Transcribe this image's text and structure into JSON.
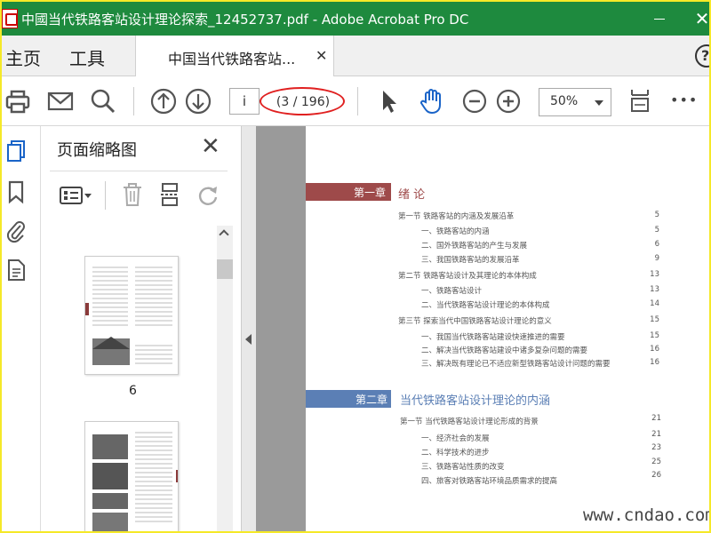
{
  "window": {
    "title": "中國当代铁路客站设计理论探索_12452737.pdf - Adobe Acrobat Pro DC",
    "minimize_glyph": "",
    "close_glyph": "✕"
  },
  "tabs": {
    "home": "主页",
    "tools": "工具",
    "document": "中国当代铁路客站...",
    "close_glyph": "✕",
    "help_glyph": "?"
  },
  "toolbar": {
    "page_input": "i",
    "page_count": "(3 / 196)",
    "zoom": "50%",
    "more_glyph": "•••"
  },
  "panel": {
    "title": "页面缩略图",
    "close_glyph": "✕",
    "thumbnails": [
      {
        "label": "6"
      }
    ]
  },
  "document": {
    "chapters": [
      {
        "label": "第一章",
        "title": "绪 论",
        "color": "#9e4a4a",
        "sections": [
          {
            "text": "第一节  铁路客站的内涵及发展沿革",
            "page": "5",
            "indent": 0
          },
          {
            "text": "一、铁路客站的内涵",
            "page": "5",
            "indent": 1
          },
          {
            "text": "二、国外铁路客站的产生与发展",
            "page": "6",
            "indent": 1
          },
          {
            "text": "三、我国铁路客站的发展沿革",
            "page": "9",
            "indent": 1
          },
          {
            "text": "第二节  铁路客站设计及其理论的本体构成",
            "page": "13",
            "indent": 0
          },
          {
            "text": "一、铁路客站设计",
            "page": "13",
            "indent": 1
          },
          {
            "text": "二、当代铁路客站设计理论的本体构成",
            "page": "14",
            "indent": 1
          },
          {
            "text": "第三节  探索当代中国铁路客站设计理论的意义",
            "page": "15",
            "indent": 0
          },
          {
            "text": "一、我国当代铁路客站建设快速推进的需要",
            "page": "15",
            "indent": 1
          },
          {
            "text": "二、解决当代铁路客站建设中诸多复杂问题的需要",
            "page": "16",
            "indent": 1
          },
          {
            "text": "三、解决既有理论已不适应新型铁路客站设计问题的需要",
            "page": "16",
            "indent": 1
          }
        ]
      },
      {
        "label": "第二章",
        "title": "当代铁路客站设计理论的内涵",
        "color": "#5b7fb5",
        "sections": [
          {
            "text": "第一节  当代铁路客站设计理论形成的背景",
            "page": "21",
            "indent": 0
          },
          {
            "text": "一、经济社会的发展",
            "page": "21",
            "indent": 1
          },
          {
            "text": "二、科学技术的进步",
            "page": "23",
            "indent": 1
          },
          {
            "text": "三、铁路客站性质的改变",
            "page": "25",
            "indent": 1
          },
          {
            "text": "四、旅客对铁路客站环境品质需求的提高",
            "page": "26",
            "indent": 1
          }
        ]
      }
    ]
  },
  "watermark": "www.cndao.com",
  "colors": {
    "titlebar": "#1e8a3e",
    "accent_blue": "#1a64c8",
    "highlight_ring": "#e02020"
  }
}
